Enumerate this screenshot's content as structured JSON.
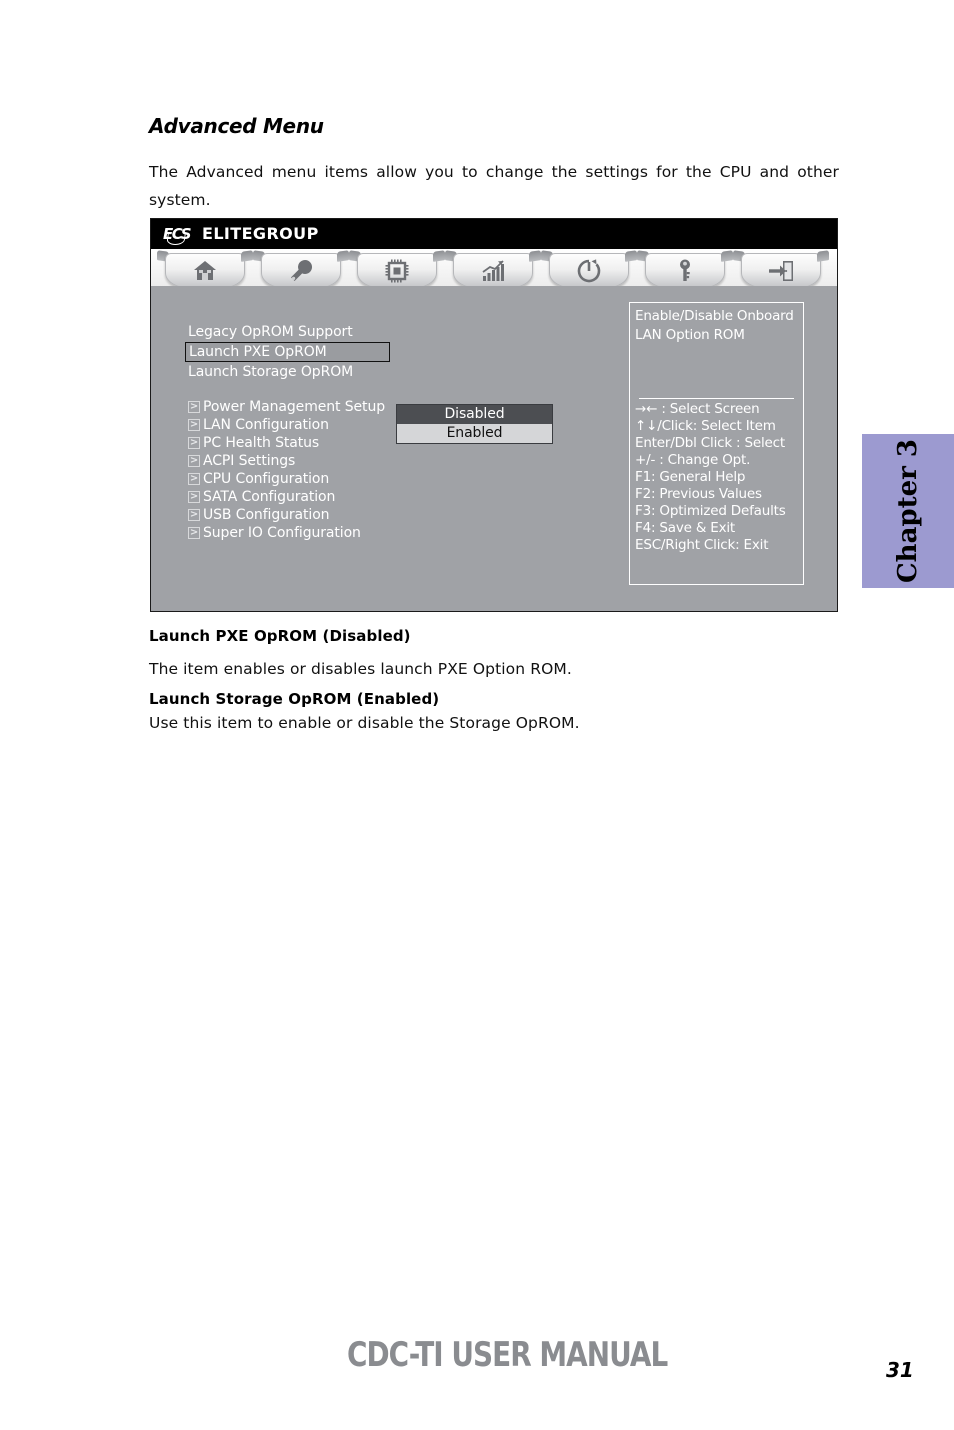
{
  "document": {
    "heading": "Advanced Menu",
    "intro": "The Advanced menu items allow you to change the settings for the CPU and other system.",
    "sections": [
      {
        "heading": "Launch PXE OpROM (Disabled)",
        "text": "The item enables or disables launch PXE Option ROM."
      },
      {
        "heading": "Launch Storage OpROM (Enabled)",
        "text": "Use this item to enable or disable the Storage OpROM."
      }
    ],
    "chapter_tab": "Chapter 3",
    "footer": {
      "title": "CDC-TI USER MANUAL",
      "page": "31"
    }
  },
  "bios": {
    "brand": {
      "mark": "ECS",
      "name": "ELITEGROUP"
    },
    "tabs": [
      {
        "label": "Main",
        "icon": "home-icon",
        "active": false
      },
      {
        "label": "Advanced",
        "icon": "wrench-icon",
        "active": true
      },
      {
        "label": "Chipset",
        "icon": "chip-icon",
        "active": false
      },
      {
        "label": "Tweak",
        "icon": "chart-trend-icon",
        "active": false
      },
      {
        "label": "Boot",
        "icon": "power-icon",
        "active": false
      },
      {
        "label": "Security",
        "icon": "key-icon",
        "active": false
      },
      {
        "label": "Exit",
        "icon": "exit-door-icon",
        "active": false
      }
    ],
    "settings": [
      {
        "label": "Legacy OpROM Support",
        "selected": false
      },
      {
        "label": "Launch PXE OpROM",
        "selected": true
      },
      {
        "label": "Launch Storage OpROM",
        "selected": false
      }
    ],
    "dropdown": {
      "options": [
        {
          "label": "Disabled",
          "selected": true
        },
        {
          "label": "Enabled",
          "selected": false
        }
      ]
    },
    "submenus": [
      "Power Management Setup",
      "LAN Configuration",
      "PC Health Status",
      "ACPI Settings",
      "CPU Configuration",
      "SATA Configuration",
      "USB Configuration",
      "Super IO Configuration"
    ],
    "help": {
      "description_line1": "Enable/Disable  Onboard",
      "description_line2": "LAN Option ROM",
      "keys": [
        "→←   : Select Screen",
        "↑↓/Click: Select Item",
        "Enter/Dbl Click : Select",
        "+/- : Change Opt.",
        "F1: General Help",
        "F2: Previous Values",
        "F3: Optimized Defaults",
        "F4: Save & Exit",
        "ESC/Right Click: Exit"
      ]
    },
    "colors": {
      "body_bg": "#a0a2a6",
      "titlebar_bg": "#000000",
      "selected_option_bg": "#4c4e52",
      "unselected_option_bg": "#d5d6d8",
      "chapter_tab_bg": "#9c9ad0",
      "footer_title": "#8a8c90"
    }
  }
}
